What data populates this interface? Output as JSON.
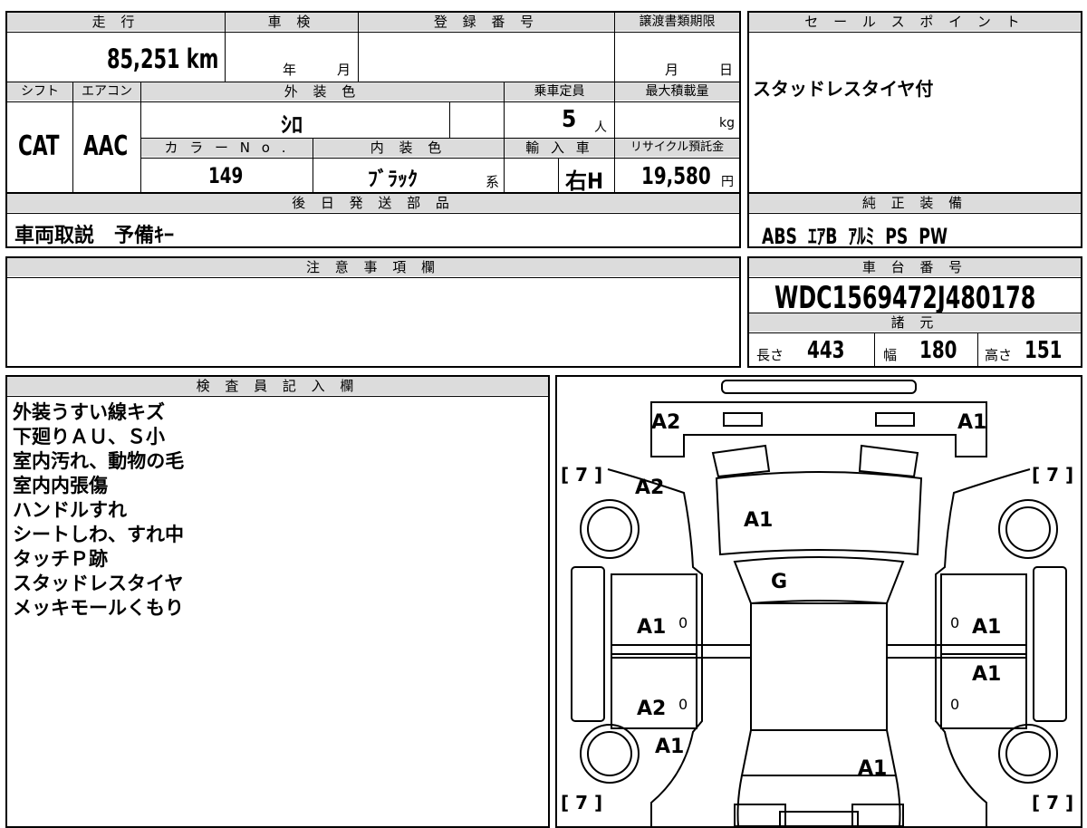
{
  "vehicle": {
    "labels": {
      "mileage": "走 行",
      "inspection": "車 検",
      "registration": "登 録 番 号",
      "transfer_deadline": "譲渡書類期限",
      "shift": "シフト",
      "aircon": "エアコン",
      "exterior_color": "外 装 色",
      "capacity": "乗車定員",
      "max_load": "最大積載量",
      "color_no": "カ ラ ー N o .",
      "interior_color": "内 装 色",
      "import": "輸 入 車",
      "recycle_fee": "リサイクル預託金",
      "later_parts": "後 日 発 送 部 品"
    },
    "mileage": "85,251 km",
    "inspection_year_unit": "年",
    "inspection_month_unit": "月",
    "deadline_month_unit": "月",
    "deadline_day_unit": "日",
    "shift": "CAT",
    "aircon": "AAC",
    "exterior_color": "ｼﾛ",
    "capacity": "5",
    "capacity_unit": "人",
    "load_unit": "kg",
    "color_no": "149",
    "interior_color": "ﾌﾞﾗｯｸ",
    "interior_suffix": "系",
    "import_type": "右H",
    "recycle_fee": "19,580",
    "recycle_unit": "円",
    "later_parts": "車両取説　予備ｷｰ"
  },
  "sales_point": {
    "label": "セ ー ル ス ポ イ ン ト",
    "text": "スタッドレスタイヤ付"
  },
  "equipment": {
    "label": "純 正 装 備",
    "text": "ABS  ｴｱB  ｱﾙﾐ  PS  PW"
  },
  "notes": {
    "label": "注 意 事 項 欄",
    "text": ""
  },
  "chassis": {
    "label": "車 台 番 号",
    "vin": "WDC1569472J480178",
    "spec_label": "諸 元",
    "length_label": "長さ",
    "length": "443",
    "width_label": "幅",
    "width": "180",
    "height_label": "高さ",
    "height": "151"
  },
  "inspector": {
    "label": "検 査 員 記 入 欄",
    "lines": [
      "外装うすい線キズ",
      "下廻りＡＵ、Ｓ小",
      "室内汚れ、動物の毛",
      "室内内張傷",
      "ハンドルすれ",
      "シートしわ、すれ中",
      "タッチＰ跡",
      "スタッドレスタイヤ",
      "メッキモールくもり"
    ]
  },
  "diagram": {
    "tread_marks": [
      "[ 7 ]",
      "[ 7 ]",
      "[ 7 ]",
      "[ 7 ]"
    ],
    "damage_codes": {
      "front_left": "A2",
      "front_right": "A1",
      "fender_left": "A2",
      "hood": "A1",
      "windshield": "G",
      "front_door_left": "A1",
      "front_door_right": "A1",
      "rear_door_left": "A2",
      "rear_door_right": "A1",
      "rear_fender_left": "A1",
      "rear": "A1"
    },
    "door_marks": [
      "0",
      "0",
      "0",
      "0"
    ]
  }
}
